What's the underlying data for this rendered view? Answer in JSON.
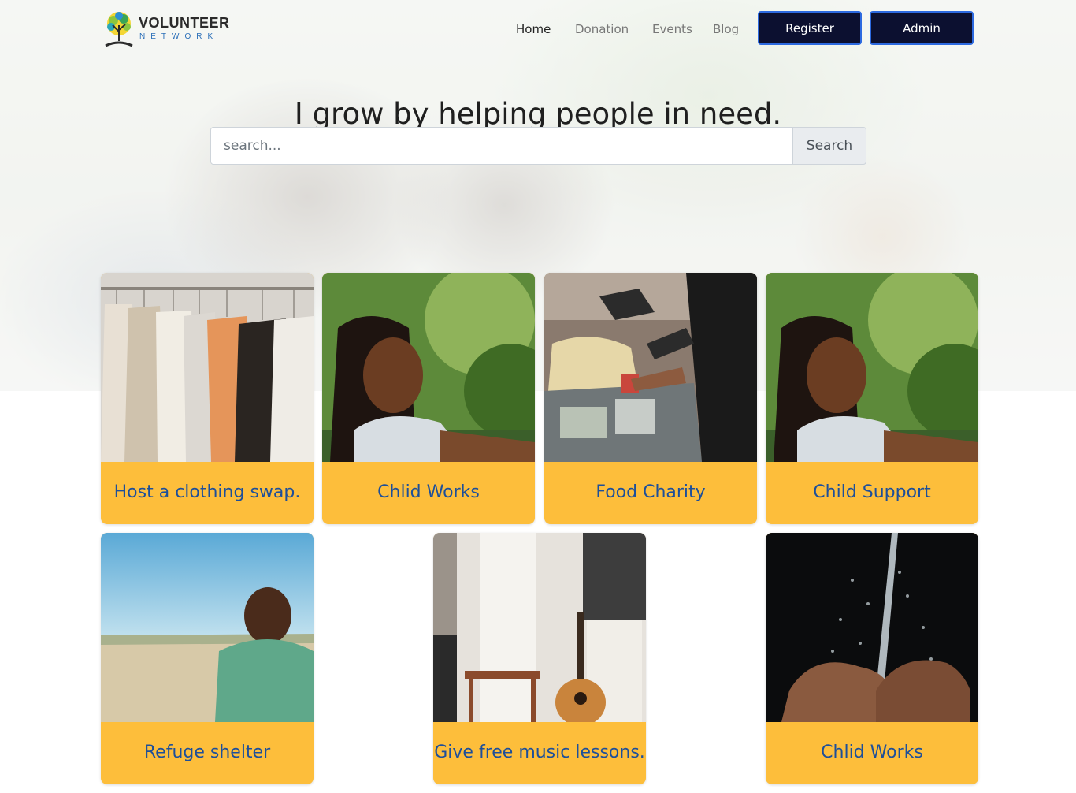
{
  "brand": {
    "name": "VOLUNTEER",
    "tagline": "NETWORK"
  },
  "nav": {
    "links": [
      {
        "label": "Home",
        "active": true
      },
      {
        "label": "Donation",
        "active": false
      },
      {
        "label": "Events",
        "active": false
      },
      {
        "label": "Blog",
        "active": false
      }
    ],
    "register_label": "Register",
    "admin_label": "Admin"
  },
  "hero": {
    "headline": "I grow by helping people in need.",
    "search_placeholder": "search...",
    "search_button": "Search"
  },
  "colors": {
    "card_footer": "#fdbe3b",
    "card_title": "#1d4f9a",
    "button_bg": "#0c1030",
    "button_border": "#2d6ae0"
  },
  "cards": [
    {
      "title": "Host a clothing swap.",
      "image": "clothing-rack-photo"
    },
    {
      "title": "Chlid Works",
      "image": "smiling-girl-photo"
    },
    {
      "title": "Food Charity",
      "image": "food-drive-photo"
    },
    {
      "title": "Child Support",
      "image": "smiling-girl-photo"
    },
    {
      "title": "Refuge shelter",
      "image": "boy-in-field-photo"
    },
    {
      "title": "Give free music lessons.",
      "image": "music-room-guitar-photo"
    },
    {
      "title": "Chlid Works",
      "image": "water-hands-photo"
    }
  ]
}
